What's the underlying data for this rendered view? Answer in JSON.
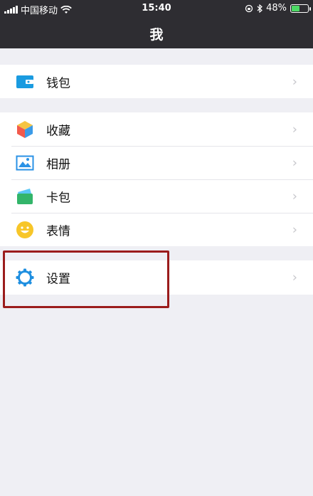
{
  "status_bar": {
    "carrier": "中国移动",
    "time": "15:40",
    "battery_percent": "48%",
    "battery_level": 0.48
  },
  "header": {
    "title": "我"
  },
  "groups": [
    {
      "items": [
        {
          "label": "钱包",
          "icon": "wallet-icon"
        }
      ]
    },
    {
      "items": [
        {
          "label": "收藏",
          "icon": "favorites-cube-icon"
        },
        {
          "label": "相册",
          "icon": "photo-album-icon"
        },
        {
          "label": "卡包",
          "icon": "card-wallet-icon"
        },
        {
          "label": "表情",
          "icon": "emoji-smile-icon"
        }
      ]
    },
    {
      "items": [
        {
          "label": "设置",
          "icon": "gear-icon"
        }
      ]
    }
  ],
  "colors": {
    "topbar": "#2e2d32",
    "background": "#efeff4",
    "highlight": "#9b1c1c"
  }
}
